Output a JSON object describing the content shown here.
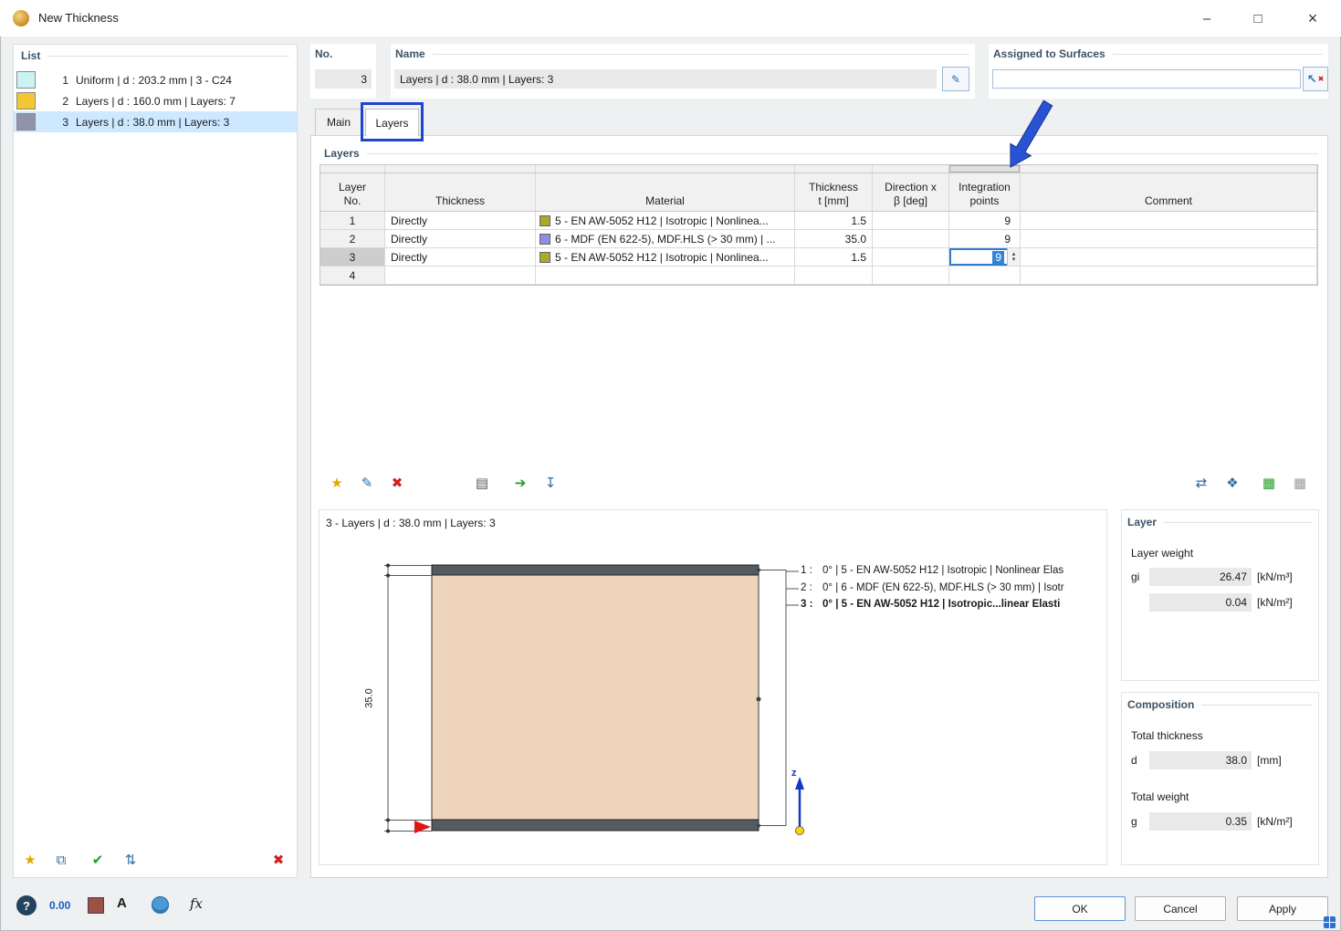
{
  "window": {
    "title": "New Thickness"
  },
  "icons": {
    "min": "–",
    "max": "□",
    "close": "×",
    "new": "★",
    "copy": "⧉",
    "check": "✔",
    "renumber": "⇅",
    "delete": "✖",
    "edit": "✎",
    "pick": "↖",
    "pick_x": "✖",
    "library": "▤",
    "import": "➔",
    "save": "↧",
    "swap": "⇄",
    "composite": "❖",
    "grid": "▦",
    "spin_up": "▴",
    "spin_down": "▾",
    "help": "?",
    "decimals": "0.00",
    "font": "A",
    "fx": "fx"
  },
  "list_panel": {
    "title": "List",
    "items": [
      {
        "num": "1",
        "label": "Uniform | d : 203.2 mm | 3 - C24"
      },
      {
        "num": "2",
        "label": "Layers | d : 160.0 mm | Layers: 7"
      },
      {
        "num": "3",
        "label": "Layers | d : 38.0 mm | Layers: 3"
      }
    ]
  },
  "header": {
    "no_label": "No.",
    "no_value": "3",
    "name_label": "Name",
    "name_value": "Layers | d : 38.0 mm | Layers: 3",
    "assigned_label": "Assigned to Surfaces",
    "assigned_value": ""
  },
  "tabs": {
    "main": "Main",
    "layers": "Layers"
  },
  "layers_box": {
    "title": "Layers",
    "headers": {
      "layer1": "Layer",
      "layer2": "No.",
      "thickness": "Thickness",
      "material": "Material",
      "t1": "Thickness",
      "t2": "t [mm]",
      "dir1": "Direction x",
      "dir2": "β [deg]",
      "int1": "Integration",
      "int2": "points",
      "comment": "Comment"
    },
    "rows": [
      {
        "no": "1",
        "thickness": "Directly",
        "material": "5 - EN AW-5052 H12 | Isotropic | Nonlinea...",
        "t": "1.5",
        "beta": "",
        "points": "9",
        "comment": ""
      },
      {
        "no": "2",
        "thickness": "Directly",
        "material": "6 - MDF (EN 622-5), MDF.HLS (> 30 mm) | ...",
        "t": "35.0",
        "beta": "",
        "points": "9",
        "comment": ""
      },
      {
        "no": "3",
        "thickness": "Directly",
        "material": "5 - EN AW-5052 H12 | Isotropic | Nonlinea...",
        "t": "1.5",
        "beta": "",
        "points": "9",
        "comment": ""
      },
      {
        "no": "4",
        "thickness": "",
        "material": "",
        "t": "",
        "beta": "",
        "points": "",
        "comment": ""
      }
    ],
    "edit_value": "9"
  },
  "preview": {
    "title": "3 - Layers | d : 38.0 mm | Layers: 3",
    "dimension": "35.0",
    "axis": "z",
    "legend": [
      {
        "no": "1 :",
        "text": "0° | 5 - EN AW-5052 H12 | Isotropic | Nonlinear Elas"
      },
      {
        "no": "2 :",
        "text": "0° | 6 - MDF (EN 622-5), MDF.HLS (> 30 mm) | Isotr"
      },
      {
        "no": "3 :",
        "text": "0° | 5 - EN AW-5052 H12 | Isotropic...linear Elasti"
      }
    ]
  },
  "layer_panel": {
    "title": "Layer",
    "weight_heading": "Layer weight",
    "gi_label": "gi",
    "gi_value": "26.47",
    "gi_unit": "[kN/m³]",
    "g2_value": "0.04",
    "g2_unit": "[kN/m²]"
  },
  "composition": {
    "title": "Composition",
    "thickness_heading": "Total thickness",
    "d_label": "d",
    "d_value": "38.0",
    "d_unit": "[mm]",
    "weight_heading": "Total weight",
    "g_label": "g",
    "g_value": "0.35",
    "g_unit": "[kN/m²]"
  },
  "buttons": {
    "ok": "OK",
    "cancel": "Cancel",
    "apply": "Apply"
  },
  "colors": {
    "swatch_uniform": "#ccf2f4",
    "swatch_layers7": "#f2c832",
    "swatch_layers3": "#9193ab",
    "material_aw5052": "#a8aa28",
    "material_mdf": "#8f8fe0",
    "section_core": "#eed4ba",
    "section_face": "#545b61",
    "annotation_blue": "#2853d4"
  }
}
